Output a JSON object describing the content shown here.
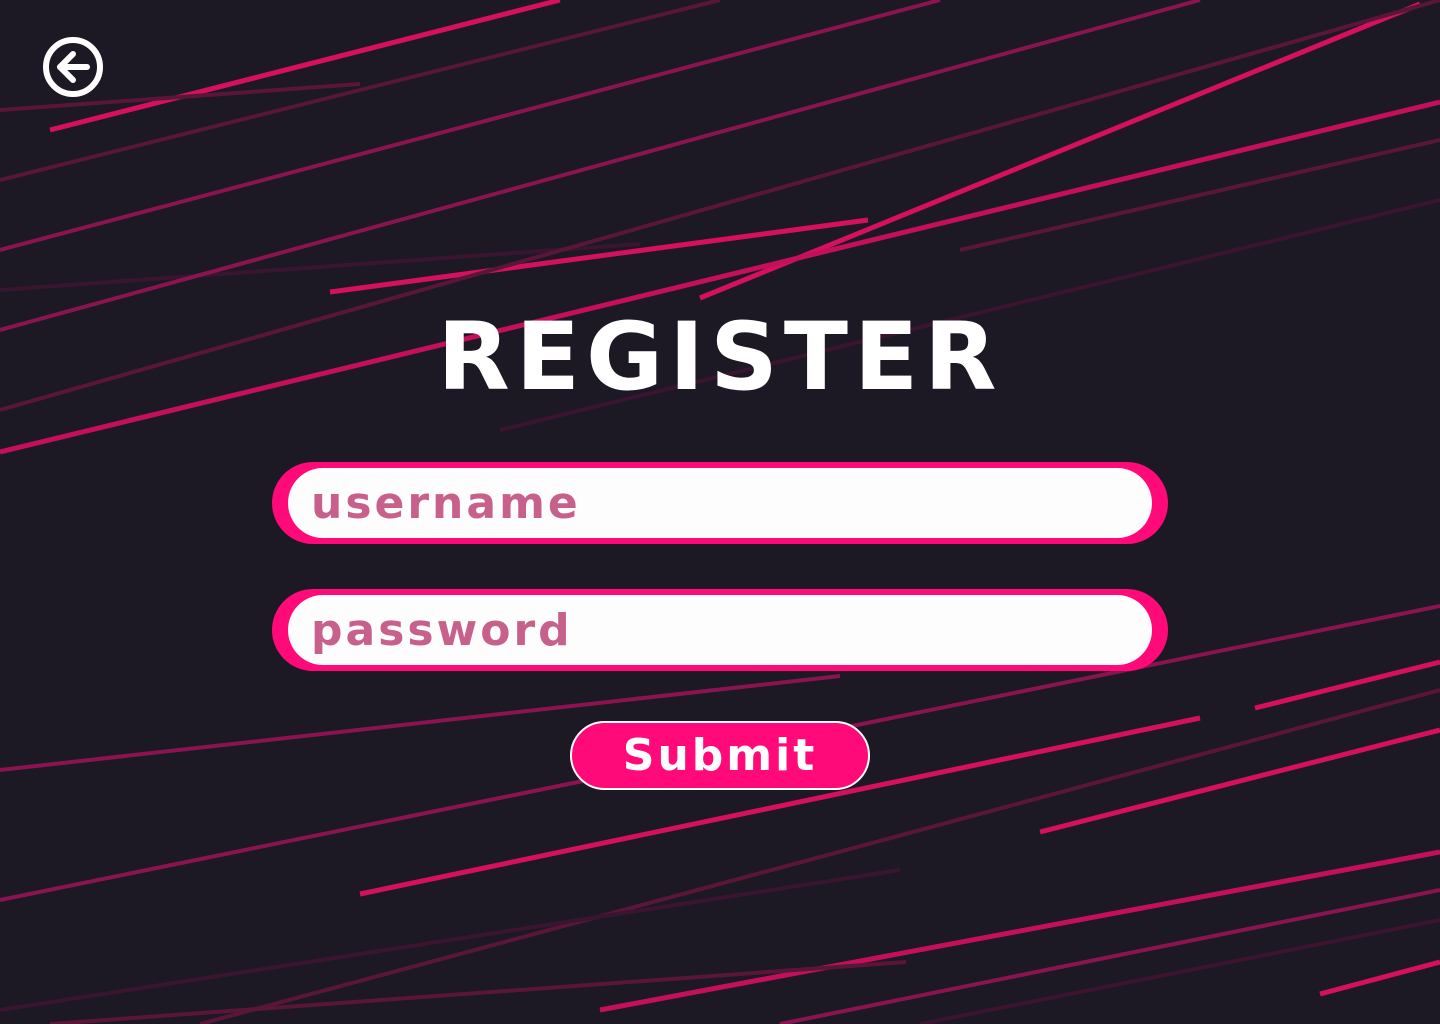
{
  "page": {
    "title": "REGISTER"
  },
  "form": {
    "username_placeholder": "username",
    "password_placeholder": "password",
    "submit_label": "Submit"
  },
  "icons": {
    "back": "arrow-left-circle-icon"
  },
  "colors": {
    "background": "#1c1824",
    "accent": "#ff0a78",
    "placeholder_text": "#c8608c",
    "field_fill": "#fcfdfc",
    "title_text": "#ffffff"
  }
}
